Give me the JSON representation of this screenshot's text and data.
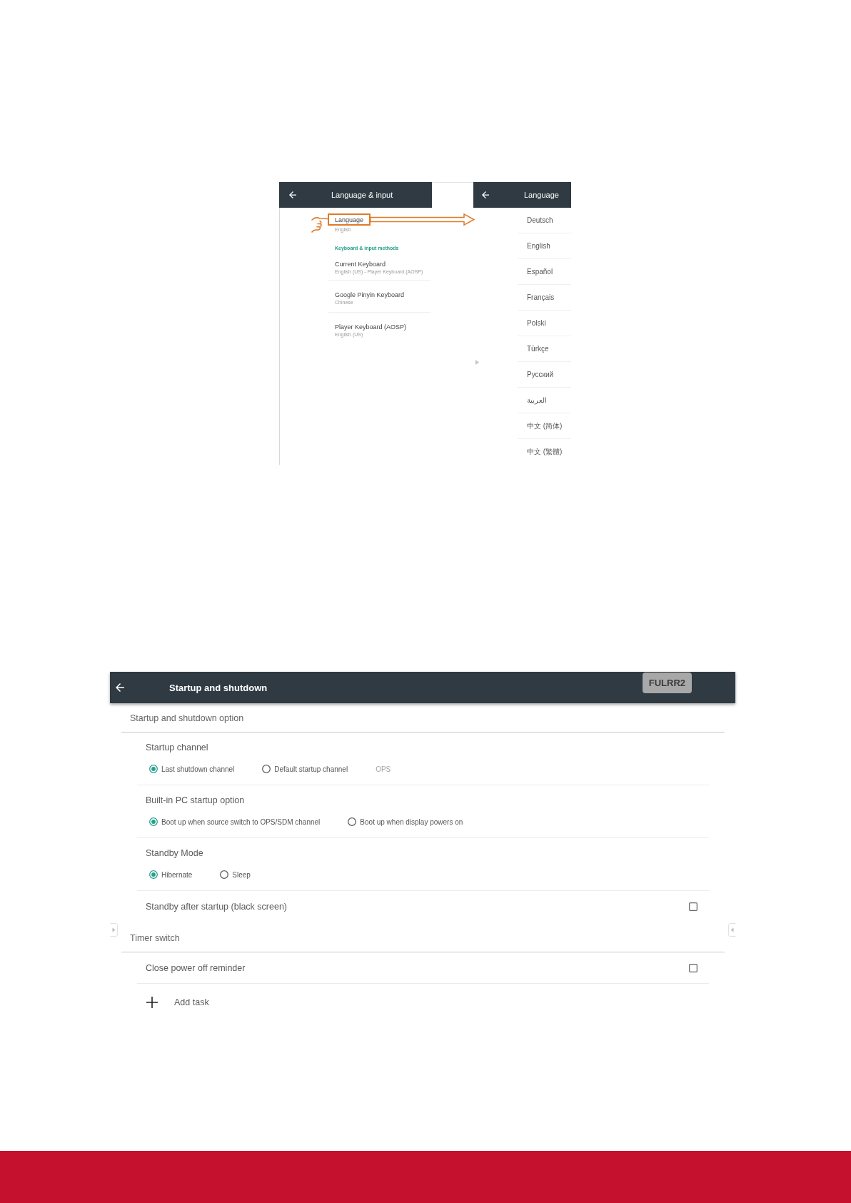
{
  "language_input_panel": {
    "title": "Language & input",
    "language": {
      "label": "Language",
      "subtitle": "English"
    },
    "section_title": "Keyboard & input methods",
    "keyboards": [
      {
        "label": "Current Keyboard",
        "subtitle": "English (US) - Player Keyboard (AOSP)"
      },
      {
        "label": "Google Pinyin Keyboard",
        "subtitle": "Chinese"
      },
      {
        "label": "Player Keyboard (AOSP)",
        "subtitle": "English (US)"
      }
    ]
  },
  "language_panel": {
    "title": "Language",
    "languages": [
      "Deutsch",
      "English",
      "Español",
      "Français",
      "Polski",
      "Türkçe",
      "Русский",
      "العربية",
      "中文 (简体)",
      "中文 (繁體)"
    ]
  },
  "startup_shutdown_panel": {
    "title": "Startup and shutdown",
    "badge": "FULRR2",
    "sections": [
      {
        "title": "Startup and shutdown option",
        "rows": [
          {
            "kind": "radio_group",
            "label": "Startup channel",
            "options": [
              {
                "label": "Last shutdown channel",
                "selected": true
              },
              {
                "label": "Default startup channel",
                "selected": false
              }
            ],
            "source": {
              "label": "OPS",
              "disabled": true
            }
          },
          {
            "kind": "radio_group",
            "label": "Built-in PC startup option",
            "options": [
              {
                "label": "Boot up when source switch to OPS/SDM channel",
                "selected": true
              },
              {
                "label": "Boot up when display powers on",
                "selected": false
              }
            ]
          },
          {
            "kind": "radio_group",
            "label": "Standby Mode",
            "options": [
              {
                "label": "Hibernate",
                "selected": true
              },
              {
                "label": "Sleep",
                "selected": false
              }
            ]
          },
          {
            "kind": "checkbox",
            "label": "Standby after startup (black screen)",
            "checked": false
          }
        ]
      },
      {
        "title": "Timer switch",
        "rows": [
          {
            "kind": "checkbox",
            "label": "Close power off reminder",
            "checked": false
          },
          {
            "kind": "add",
            "label": "Add task"
          }
        ]
      }
    ]
  }
}
